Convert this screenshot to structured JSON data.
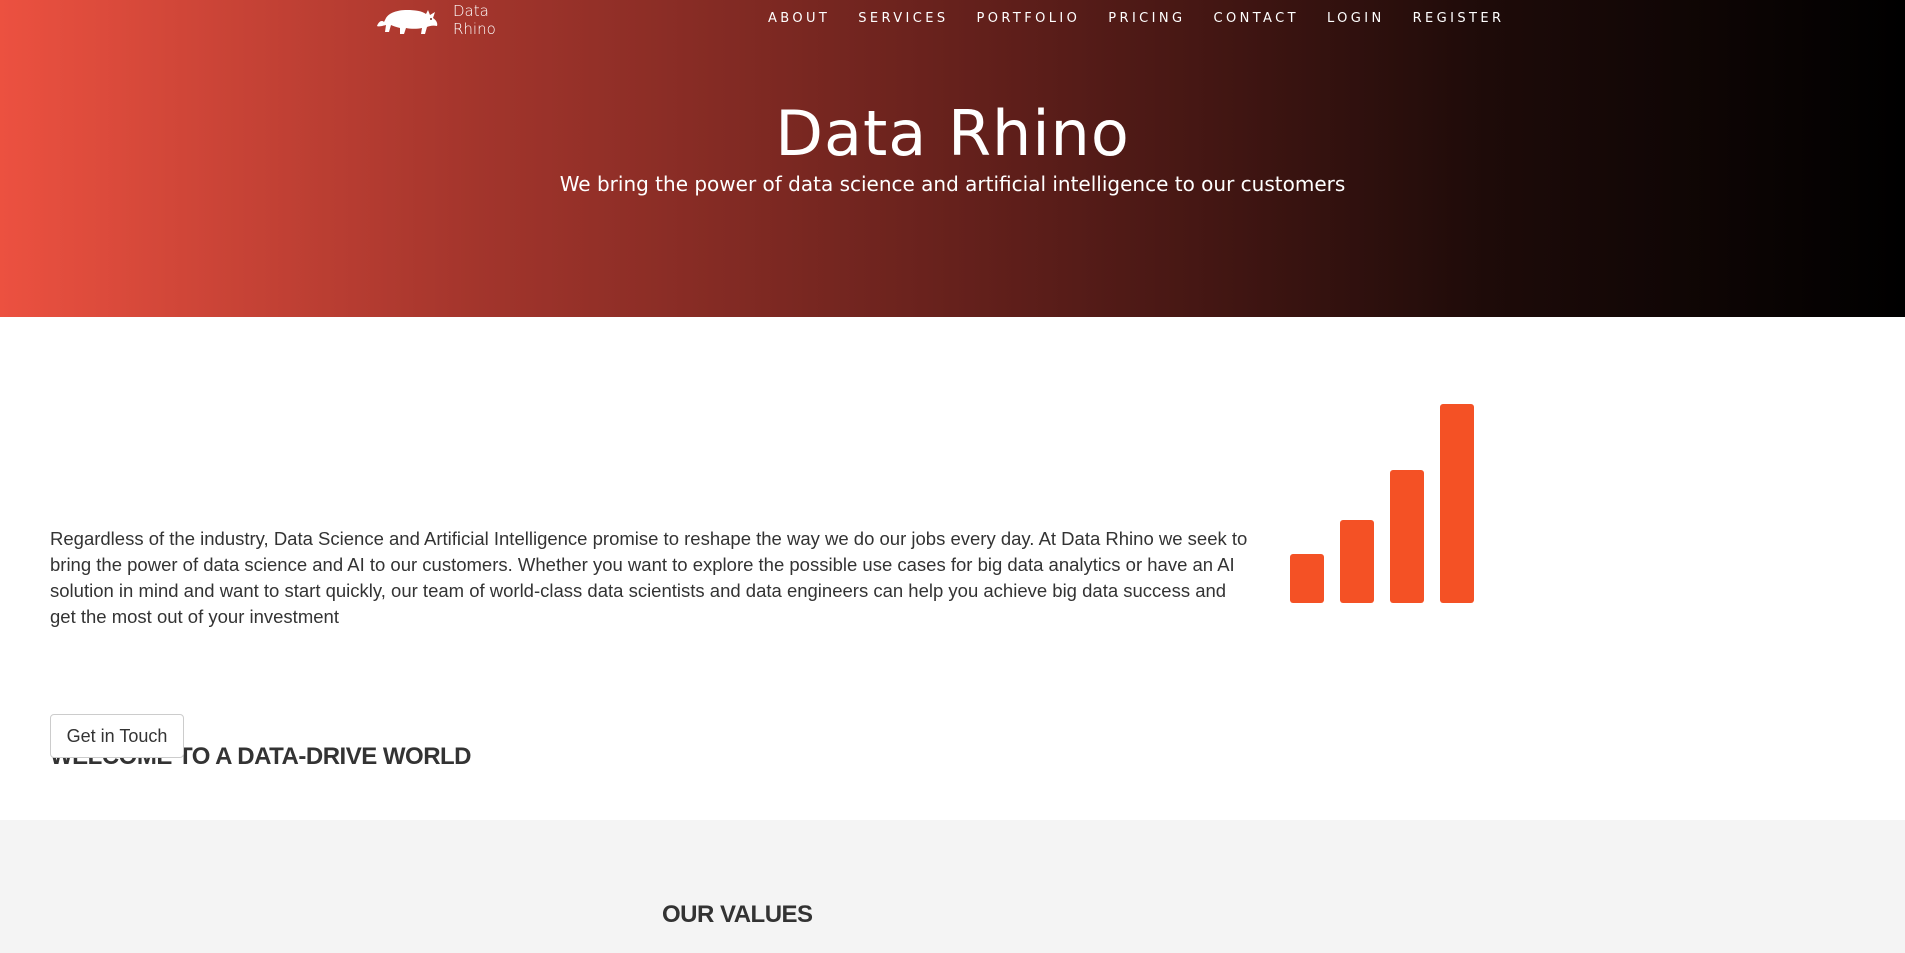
{
  "header": {
    "brand": {
      "line1": "Data",
      "line2": "Rhino",
      "logo_icon": "rhino-icon"
    },
    "nav": [
      "ABOUT",
      "SERVICES",
      "PORTFOLIO",
      "PRICING",
      "CONTACT",
      "LOGIN",
      "REGISTER"
    ]
  },
  "hero": {
    "title": "Data Rhino",
    "subtitle": "We bring the power of data science and artificial intelligence to our customers",
    "gradient_colors": [
      "#ec5140",
      "#000000"
    ]
  },
  "welcome": {
    "heading": "WELCOME TO A DATA-DRIVE WORLD",
    "body": "Regardless of the industry, Data Science and Artificial Intelligence promise to reshape the way we do our jobs every day. At Data Rhino we seek to bring the power of data science and AI to our customers. Whether you want to explore the possible use cases for big data analytics or have an AI solution in mind and want to start quickly, our team of world-class data scientists and data engineers can help you achieve big data success and get the most out of your investment",
    "cta_label": "Get in Touch",
    "graphic_icon": "bar-chart-icon",
    "accent_color": "#f45125"
  },
  "values": {
    "heading": "OUR VALUES"
  }
}
